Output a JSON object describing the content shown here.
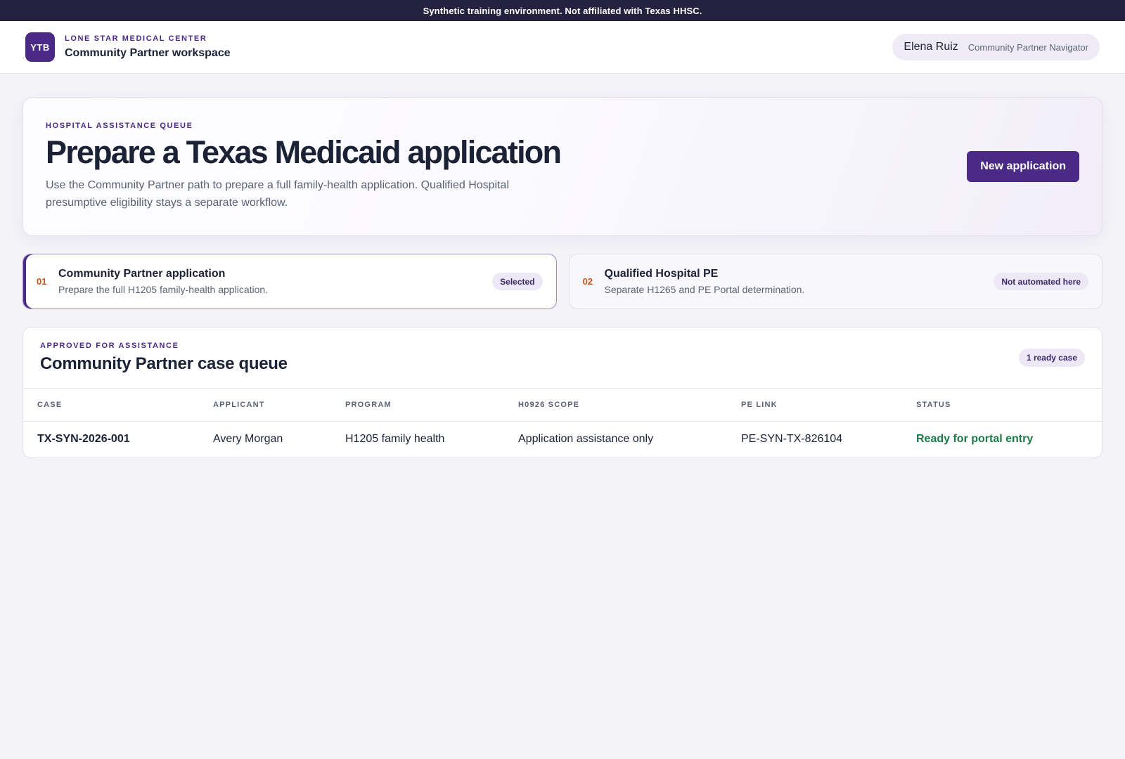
{
  "banner": "Synthetic training environment. Not affiliated with Texas HHSC.",
  "header": {
    "logo_text": "YTB",
    "org_name": "LONE STAR MEDICAL CENTER",
    "workspace": "Community Partner workspace",
    "user_name": "Elena Ruiz",
    "user_role": "Community Partner Navigator"
  },
  "hero": {
    "eyebrow": "HOSPITAL ASSISTANCE QUEUE",
    "title": "Prepare a Texas Medicaid application",
    "description": "Use the Community Partner path to prepare a full family-health application. Qualified Hospital presumptive eligibility stays a separate workflow.",
    "button_label": "New application"
  },
  "paths": [
    {
      "number": "01",
      "title": "Community Partner application",
      "subtitle": "Prepare the full H1205 family-health application.",
      "badge": "Selected",
      "selected": true
    },
    {
      "number": "02",
      "title": "Qualified Hospital PE",
      "subtitle": "Separate H1265 and PE Portal determination.",
      "badge": "Not automated here",
      "selected": false
    }
  ],
  "queue": {
    "eyebrow": "APPROVED FOR ASSISTANCE",
    "title": "Community Partner case queue",
    "badge": "1 ready case",
    "columns": [
      "CASE",
      "APPLICANT",
      "PROGRAM",
      "H0926 SCOPE",
      "PE LINK",
      "STATUS"
    ],
    "rows": [
      {
        "case": "TX-SYN-2026-001",
        "applicant": "Avery Morgan",
        "program": "H1205 family health",
        "scope": "Application assistance only",
        "pe_link": "PE-SYN-TX-826104",
        "status": "Ready for portal entry"
      }
    ]
  },
  "colors": {
    "accent": "#4a2a86",
    "banner_bg": "#25223f",
    "status_ready": "#1b7a46",
    "number": "#c4561b"
  }
}
